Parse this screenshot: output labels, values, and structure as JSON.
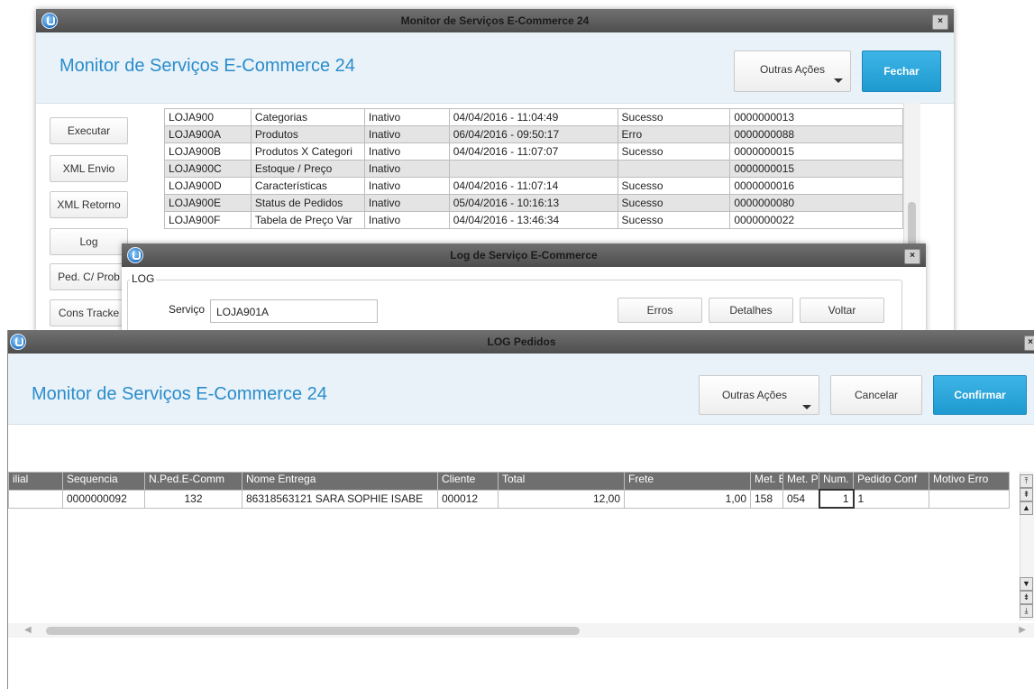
{
  "win1": {
    "title": "Monitor de Serviços E-Commerce 24",
    "header_title": "Monitor de Serviços E-Commerce 24",
    "outras_acoes": "Outras Ações",
    "fechar": "Fechar",
    "close_glyph": "×",
    "side_buttons": [
      "Executar",
      "XML Envio",
      "XML Retorno",
      "Log",
      "Ped. C/ Prob",
      "Cons Tracke"
    ],
    "rows": [
      [
        "LOJA900",
        "Categorias",
        "Inativo",
        "04/04/2016 - 11:04:49",
        "Sucesso",
        "0000000013"
      ],
      [
        "LOJA900A",
        "Produtos",
        "Inativo",
        "06/04/2016 - 09:50:17",
        "Erro",
        "0000000088"
      ],
      [
        "LOJA900B",
        "Produtos X Categori",
        "Inativo",
        "04/04/2016 - 11:07:07",
        "Sucesso",
        "0000000015"
      ],
      [
        "LOJA900C",
        "Estoque / Preço",
        "Inativo",
        "",
        "",
        "0000000015"
      ],
      [
        "LOJA900D",
        "Características",
        "Inativo",
        "04/04/2016 - 11:07:14",
        "Sucesso",
        "0000000016"
      ],
      [
        "LOJA900E",
        "Status de Pedidos",
        "Inativo",
        "05/04/2016 - 10:16:13",
        "Sucesso",
        "0000000080"
      ],
      [
        "LOJA900F",
        "Tabela de Preço Var",
        "Inativo",
        "04/04/2016 - 13:46:34",
        "Sucesso",
        "0000000022"
      ]
    ]
  },
  "win2": {
    "title": "Log de Serviço E-Commerce",
    "close_glyph": "×",
    "legend": "LOG",
    "servico_label": "Serviço",
    "servico_value": "LOJA901A",
    "erros": "Erros",
    "detalhes": "Detalhes",
    "voltar": "Voltar"
  },
  "win3": {
    "title": "LOG Pedidos",
    "close_glyph": "×",
    "header_title": "Monitor de Serviços E-Commerce 24",
    "outras_acoes": "Outras Ações",
    "cancelar": "Cancelar",
    "confirmar": "Confirmar",
    "columns": [
      "ilial",
      "Sequencia",
      "N.Ped.E-Comm",
      "Nome Entrega",
      "Cliente",
      "Total",
      "Frete",
      "Met. E",
      "Met. P",
      "Num. P",
      "Pedido Conf",
      "Motivo Erro"
    ],
    "row": [
      "",
      "0000000092",
      "132",
      "86318563121 SARA SOPHIE ISABE",
      "000012",
      "12,00",
      "1,00",
      "158",
      "054",
      "1",
      "1",
      ""
    ]
  },
  "colors": {
    "accent": "#2a8ccd",
    "primary_button": "#1e9ad0",
    "titlebar": "#5a5a5a",
    "header_band": "#e9f2f8"
  }
}
